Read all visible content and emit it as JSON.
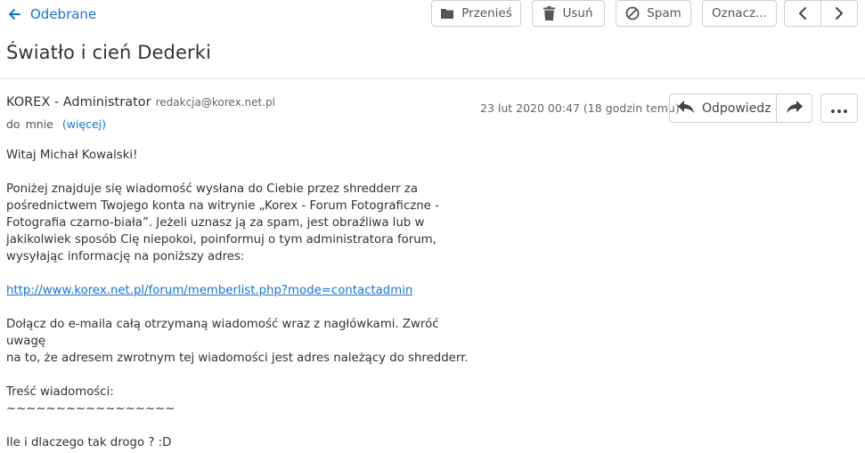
{
  "nav": {
    "back_label": "Odebrane"
  },
  "toolbar": {
    "move_label": "Przenieś",
    "delete_label": "Usuń",
    "spam_label": "Spam",
    "mark_label": "Oznacz..."
  },
  "message": {
    "subject": "Światło i cień Dederki",
    "from_name": "KOREX - Administrator",
    "from_email": "redakcja@korex.net.pl",
    "to_prefix": "do",
    "to_name": "mnie",
    "more_label": "(więcej)",
    "date": "23 lut 2020 00:47 (18 godzin temu)",
    "reply_label": "Odpowiedz",
    "body": {
      "greeting": "Witaj Michał Kowalski!",
      "paragraph1_line1": "Poniżej znajduje się wiadomość wysłana do Ciebie przez shredderr za",
      "paragraph1_line2": "pośrednictwem Twojego konta na witrynie „Korex - Forum Fotograficzne -",
      "paragraph1_line3": "Fotografia czarno-biała”. Jeżeli uznasz ją za spam, jest obraźliwa lub w",
      "paragraph1_line4": "jakikolwiek sposób Cię niepokoi, poinformuj o tym administratora forum,",
      "paragraph1_line5": "wysyłając informację na poniższy adres:",
      "link": "http://www.korex.net.pl/forum/memberlist.php?mode=contactadmin",
      "paragraph2_line1": "Dołącz do e-maila całą otrzymaną wiadomość wraz z nagłówkami. Zwróć uwagę",
      "paragraph2_line2": "na to, że adresem zwrotnym tej wiadomości jest adres należący do shredderr.",
      "content_label": "Treść wiadomości:",
      "separator": "~~~~~~~~~~~~~~~~~",
      "content": "Ile i dlaczego tak drogo ? :D"
    }
  },
  "colors": {
    "accent": "#1a73d1",
    "border": "#cfcfcf",
    "text": "#333333"
  },
  "icons": [
    "arrow-left-icon",
    "folder-icon",
    "trash-icon",
    "ban-icon",
    "chevron-left-icon",
    "chevron-right-icon",
    "reply-icon",
    "forward-icon",
    "dots-icon"
  ]
}
